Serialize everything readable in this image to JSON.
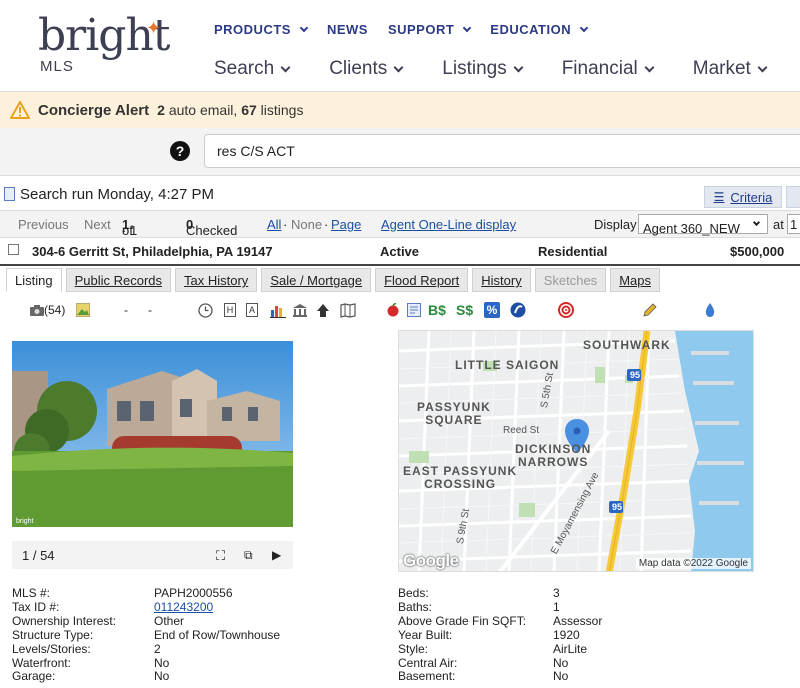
{
  "logo": {
    "word": "bright",
    "sub": "MLS"
  },
  "top_nav": [
    {
      "label": "PRODUCTS",
      "dropdown": true
    },
    {
      "label": "NEWS",
      "dropdown": false
    },
    {
      "label": "SUPPORT",
      "dropdown": true
    },
    {
      "label": "EDUCATION",
      "dropdown": true
    }
  ],
  "main_nav": [
    "Search",
    "Clients",
    "Listings",
    "Financial",
    "Market"
  ],
  "alert": {
    "title": "Concierge Alert",
    "auto_email_count": "2",
    "auto_email_text": "auto email,",
    "listings_count": "67",
    "listings_text": "listings"
  },
  "search": {
    "value": "res C/S ACT"
  },
  "run": {
    "text": "Search run Monday, 4:27 PM",
    "criteria_label": "Criteria"
  },
  "pager": {
    "previous": "Previous",
    "next": "Next",
    "position_prefix": "· 1",
    "position_of": "of",
    "position_total": "1",
    "checked_label": "Checked",
    "checked_count": "0",
    "all": "All",
    "sep": "·",
    "none": "None",
    "sep2": "·",
    "page": "Page",
    "agent_one_line": "Agent One-Line display",
    "display_label": "Display",
    "display_value": "Agent 360_NEW",
    "at_label": "at",
    "at_value": "1"
  },
  "listing": {
    "address": "304-6 Gerritt St, Philadelphia, PA 19147",
    "status": "Active",
    "type": "Residential",
    "price": "$500,000"
  },
  "tabs": [
    {
      "label": "Listing",
      "state": "active"
    },
    {
      "label": "Public Records",
      "state": "normal"
    },
    {
      "label": "Tax History",
      "state": "normal"
    },
    {
      "label": "Sale / Mortgage",
      "state": "normal"
    },
    {
      "label": "Flood Report",
      "state": "normal"
    },
    {
      "label": "History",
      "state": "normal"
    },
    {
      "label": "Sketches",
      "state": "disabled"
    },
    {
      "label": "Maps",
      "state": "normal"
    }
  ],
  "toolbar": {
    "photo_count": "(54)",
    "dash1": "-",
    "dash2": "-",
    "bs": "B$",
    "ss": "S$",
    "percent": "%"
  },
  "photo": {
    "counter": "1 / 54",
    "watermark": "bright"
  },
  "map": {
    "labels": {
      "southwark": "SOUTHWARK",
      "little_saigon": "LITTLE SAIGON",
      "passyunk_square": "PASSYUNK\nSQUARE",
      "dickinson": "DICKINSON\nNARROWS",
      "east_passyunk": "EAST PASSYUNK\nCROSSING",
      "reed": "Reed St",
      "s5th": "S 5th St",
      "s9th": "S 9th St",
      "moya": "E Moyamensing Ave",
      "i95": "95"
    },
    "google": "Google",
    "credit": "Map data ©2022 Google"
  },
  "details_left": [
    {
      "label": "MLS #:",
      "value": "PAPH2000556",
      "link": false
    },
    {
      "label": "Tax ID #:",
      "value": "011243200",
      "link": true
    },
    {
      "label": "Ownership Interest:",
      "value": "Other",
      "link": false
    },
    {
      "label": "Structure Type:",
      "value": "End of Row/Townhouse",
      "link": false
    },
    {
      "label": "Levels/Stories:",
      "value": "2",
      "link": false
    },
    {
      "label": "Waterfront:",
      "value": "No",
      "link": false
    },
    {
      "label": "Garage:",
      "value": "No",
      "link": false
    }
  ],
  "details_right": [
    {
      "label": "Beds:",
      "value": "3",
      "link": false
    },
    {
      "label": "Baths:",
      "value": "1",
      "link": false
    },
    {
      "label": "Above Grade Fin SQFT:",
      "value": "Assessor",
      "link": false
    },
    {
      "label": "Year Built:",
      "value": "1920",
      "link": false
    },
    {
      "label": "Style:",
      "value": "AirLite",
      "link": false
    },
    {
      "label": "Central Air:",
      "value": "No",
      "link": false
    },
    {
      "label": "Basement:",
      "value": "No",
      "link": false
    }
  ],
  "colors": {
    "brand_navy": "#2c3a85",
    "brand_orange": "#e8772e",
    "alert_bg": "#fdf1dc",
    "link": "#1c4fa3"
  }
}
